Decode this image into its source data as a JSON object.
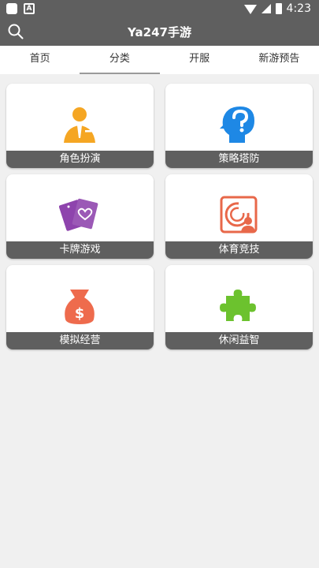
{
  "status": {
    "time": "4:23"
  },
  "header": {
    "title": "Ya247手游"
  },
  "tabs": [
    "首页",
    "分类",
    "开服",
    "新游预告"
  ],
  "categories": [
    {
      "label": "角色扮演",
      "icon": "person-icon",
      "color": "#f5a623"
    },
    {
      "label": "策略塔防",
      "icon": "question-head-icon",
      "color": "#1e88e5"
    },
    {
      "label": "卡牌游戏",
      "icon": "cards-icon",
      "color": "#8e44ad"
    },
    {
      "label": "体育竞技",
      "icon": "sports-icon",
      "color": "#e8684a"
    },
    {
      "label": "模拟经营",
      "icon": "money-bag-icon",
      "color": "#ee6b4d"
    },
    {
      "label": "休闲益智",
      "icon": "puzzle-icon",
      "color": "#6cc22e"
    }
  ]
}
